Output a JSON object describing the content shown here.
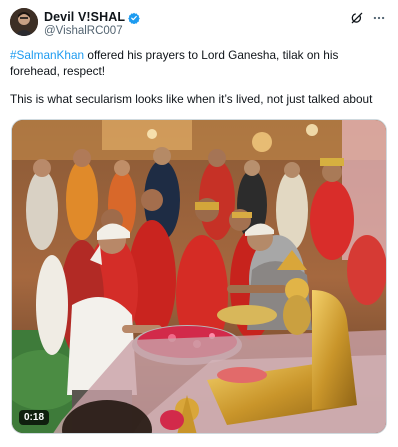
{
  "author": {
    "display_name": "Devil V!SHAL",
    "handle": "@VishalRC007",
    "verified": true
  },
  "icons": {
    "verified": "verified-badge-icon",
    "grok": "grok-icon",
    "more": "more-horizontal-icon",
    "avatar": "avatar"
  },
  "tweet": {
    "hashtag": "#SalmanKhan",
    "line1_rest": " offered his prayers to Lord Ganesha, tilak on his forehead, respect!",
    "line2": "This is what secularism looks like when it’s lived, not just talked about"
  },
  "media": {
    "type": "video",
    "duration": "0:18"
  },
  "colors": {
    "link": "#1d9bf0",
    "verified": "#1d9bf0",
    "text": "#0f1419",
    "secondary": "#536471"
  }
}
